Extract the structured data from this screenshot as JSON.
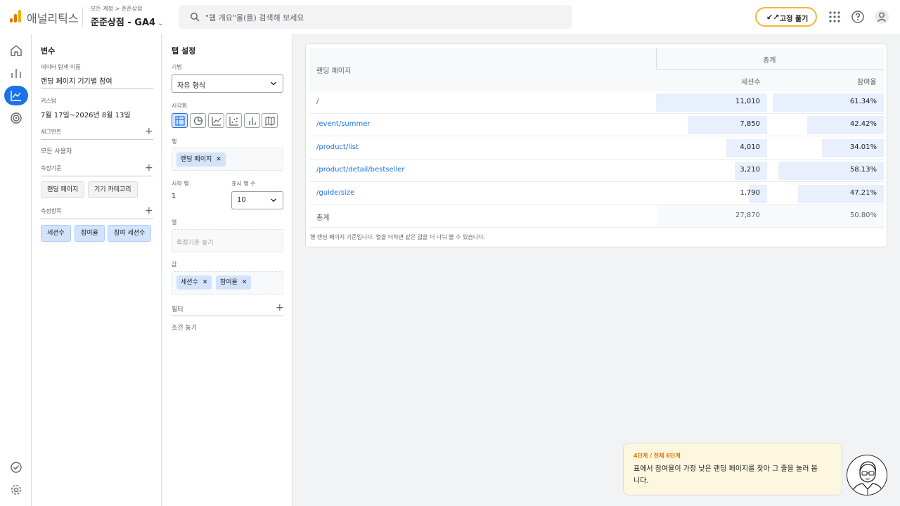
{
  "header": {
    "app_name": "애널리틱스",
    "breadcrumb": "모든 계정 > 준준상점",
    "property": "준준상점 - GA4",
    "search_placeholder": "\"웹 개요\"을(를) 검색해 보세요",
    "pin_button": "고정 풀기"
  },
  "variables": {
    "title": "변수",
    "exploration_name_label": "데이터 탐색 이름",
    "exploration_name": "랜딩 페이지 기기별 참여",
    "custom_label": "커스텀",
    "date_range": "7월 17일~2026년 8월 13일",
    "segments_label": "세그먼트",
    "segment_value": "모든 사용자",
    "dimensions_label": "측정기준",
    "dimensions": [
      "랜딩 페이지",
      "기기 카테고리"
    ],
    "metrics_label": "측정항목",
    "metrics": [
      "세션수",
      "참여율",
      "참여 세션수"
    ]
  },
  "tab_settings": {
    "title": "탭 설정",
    "technique_label": "기법",
    "technique_value": "자유 형식",
    "visualization_label": "시각화",
    "rows_label": "행",
    "row_chip": "랜딩 페이지",
    "start_row_label": "시작 행",
    "start_row_value": "1",
    "show_rows_label": "표시 행 수",
    "show_rows_value": "10",
    "columns_label": "열",
    "columns_placeholder": "측정기준 놓기",
    "values_label": "값",
    "value_chips": [
      "세션수",
      "참여율"
    ],
    "filters_label": "필터",
    "filters_placeholder": "조건 놓기"
  },
  "table": {
    "dim_header": "랜딩 페이지",
    "group_header": "총계",
    "metric_headers": [
      "세션수",
      "참여율"
    ],
    "rows": [
      {
        "page": "/",
        "sessions": "11,010",
        "rate": "61.34%"
      },
      {
        "page": "/event/summer",
        "sessions": "7,850",
        "rate": "42.42%"
      },
      {
        "page": "/product/list",
        "sessions": "4,010",
        "rate": "34.01%"
      },
      {
        "page": "/product/detail/bestseller",
        "sessions": "3,210",
        "rate": "58.13%"
      },
      {
        "page": "/guide/size",
        "sessions": "1,790",
        "rate": "47.21%"
      }
    ],
    "total": {
      "label": "총계",
      "sessions": "27,870",
      "rate": "50.80%"
    },
    "note": "행 랜딩 페이지 기준입니다. 열을 더하면 같은 값을 더 나눠 볼 수 있습니다.",
    "bar_fraction": {
      "sessions": [
        1.0,
        0.713,
        0.364,
        0.292,
        0.163
      ],
      "rate": [
        1.0,
        0.692,
        0.554,
        0.948,
        0.77
      ]
    }
  },
  "tooltip": {
    "step": "4단계 / 전체 6단계",
    "message": "표에서 참여율이 가장 낮은 랜딩 페이지를 찾아 그 줄을 눌러 봅니다."
  },
  "colors": {
    "accent": "#1a73e8",
    "bar": "#e8f0fe",
    "pin_border": "#f2b53c"
  }
}
